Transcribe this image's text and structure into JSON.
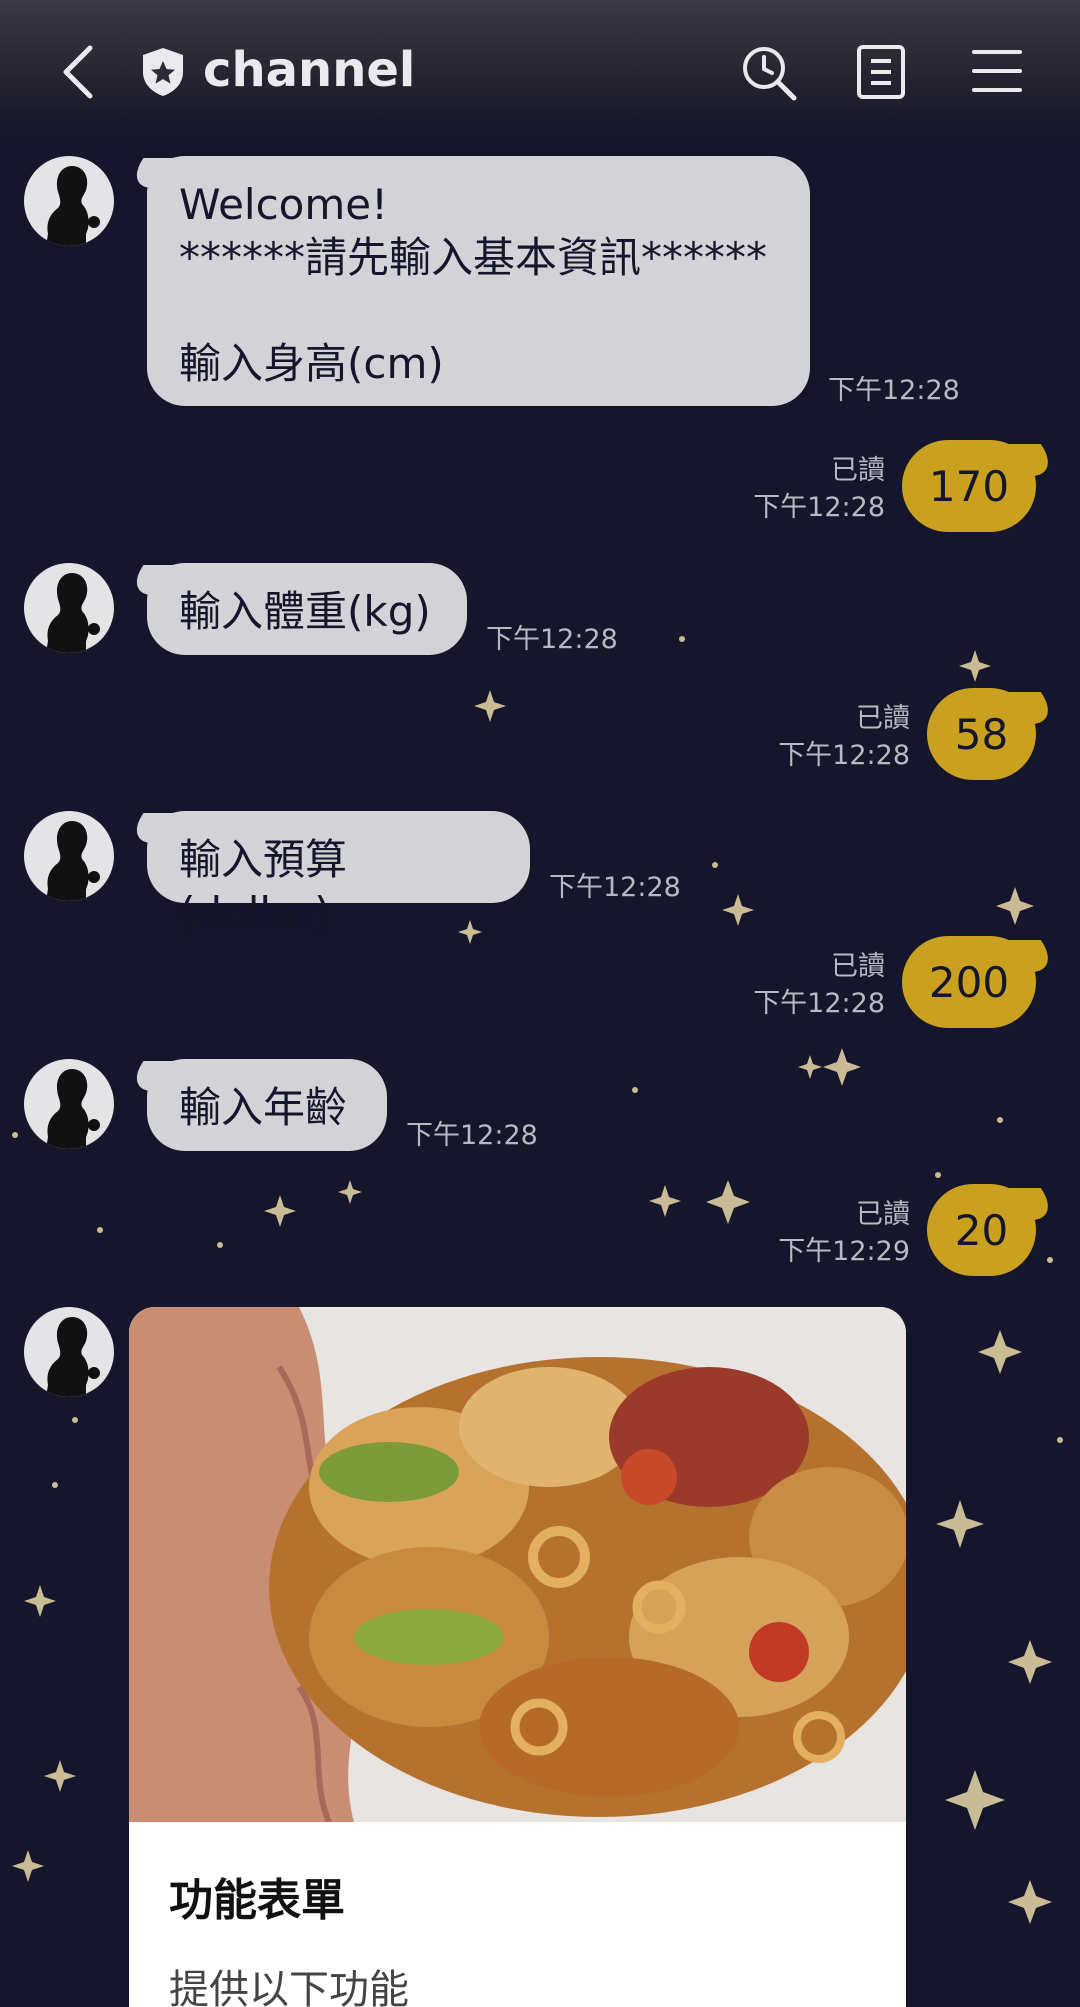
{
  "header": {
    "title": "channel",
    "icons": [
      "back-chevron-icon",
      "shield-star-icon",
      "search-clock-icon",
      "notes-icon",
      "menu-icon"
    ]
  },
  "messages": [
    {
      "from": "bot",
      "text": "Welcome!\n******請先輸入基本資訊******\n\n輸入身高(cm)",
      "time": "下午12:28"
    },
    {
      "from": "user",
      "text": "170",
      "read": "已讀",
      "time": "下午12:28"
    },
    {
      "from": "bot",
      "text": "輸入體重(kg)",
      "time": "下午12:28"
    },
    {
      "from": "user",
      "text": "58",
      "read": "已讀",
      "time": "下午12:28"
    },
    {
      "from": "bot",
      "text": "輸入預算(dollar)",
      "time": "下午12:28"
    },
    {
      "from": "user",
      "text": "200",
      "read": "已讀",
      "time": "下午12:28"
    },
    {
      "from": "bot",
      "text": "輸入年齡",
      "time": "下午12:28"
    },
    {
      "from": "user",
      "text": "20",
      "read": "已讀",
      "time": "下午12:29"
    }
  ],
  "card": {
    "title": "功能表單",
    "subtitle": "提供以下功能"
  },
  "colors": {
    "background": "#15152b",
    "bot_bubble": "#d3d3d7",
    "user_bubble": "#c9a11e",
    "timestamp": "#b8b8c2"
  }
}
